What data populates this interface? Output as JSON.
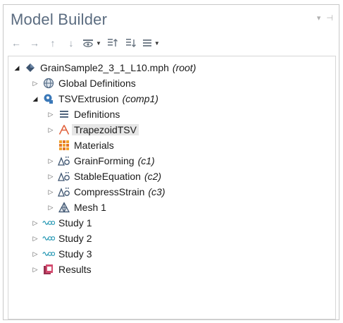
{
  "panel": {
    "title": "Model Builder",
    "title_controls": [
      "▾",
      "⊣",
      "✕"
    ]
  },
  "toolbar": {
    "items": [
      {
        "name": "back-button",
        "glyph": "←"
      },
      {
        "name": "forward-button",
        "glyph": "→"
      },
      {
        "name": "move-up-button",
        "glyph": "↑"
      },
      {
        "name": "move-down-button",
        "glyph": "↓"
      },
      {
        "name": "show-dropdown",
        "glyph": "👁"
      },
      {
        "name": "collapse-all-button",
        "glyph": "⇡"
      },
      {
        "name": "expand-all-button",
        "glyph": "⇣"
      },
      {
        "name": "list-dropdown",
        "glyph": "≣"
      }
    ]
  },
  "tree": {
    "root": {
      "label": "GrainSample2_3_1_L10.mph",
      "tag": "(root)",
      "icon": "model-file-icon"
    },
    "global_definitions": {
      "label": "Global Definitions",
      "icon": "globe-icon"
    },
    "component": {
      "label": "TSVExtrusion",
      "tag": "(comp1)",
      "icon": "component-icon"
    },
    "definitions": {
      "label": "Definitions",
      "icon": "definitions-icon"
    },
    "geometry": {
      "label": "TrapezoidTSV",
      "icon": "geometry-icon"
    },
    "materials": {
      "label": "Materials",
      "icon": "materials-icon"
    },
    "physics": [
      {
        "label": "GrainForming",
        "tag": "(c1)",
        "icon": "physics-icon"
      },
      {
        "label": "StableEquation",
        "tag": "(c2)",
        "icon": "physics-icon"
      },
      {
        "label": "CompressStrain",
        "tag": "(c3)",
        "icon": "physics-icon"
      }
    ],
    "mesh": {
      "label": "Mesh 1",
      "icon": "mesh-icon"
    },
    "studies": [
      {
        "label": "Study 1",
        "icon": "study-icon"
      },
      {
        "label": "Study 2",
        "icon": "study-icon"
      },
      {
        "label": "Study 3",
        "icon": "study-icon"
      }
    ],
    "results": {
      "label": "Results",
      "icon": "results-icon"
    }
  },
  "colors": {
    "title": "#5b6c80",
    "selected_row": "#e6e6e6",
    "study_icon": "#2a9ab5",
    "geometry_icon": "#e0603a",
    "materials_icon": "#f2a12a",
    "component_icon": "#3a78b8"
  }
}
